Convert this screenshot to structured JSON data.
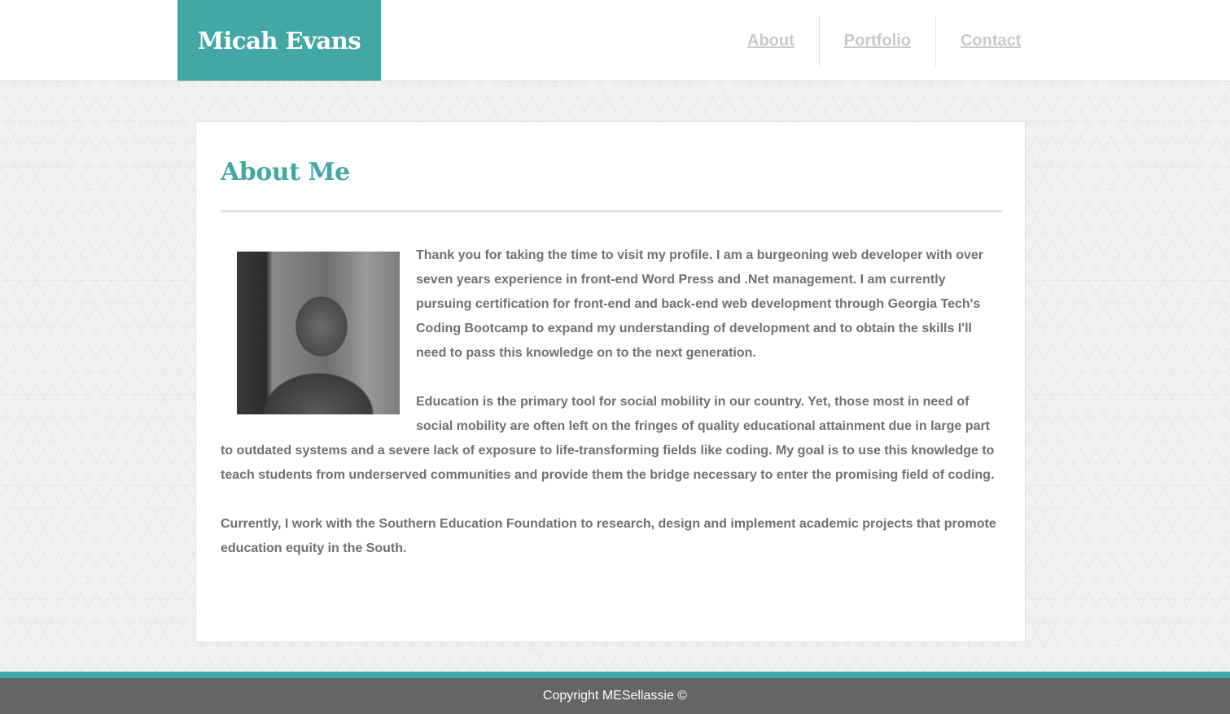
{
  "header": {
    "brand": "Micah Evans",
    "nav": [
      "About",
      "Portfolio",
      "Contact"
    ]
  },
  "about": {
    "title": "About Me",
    "photo_icon": "profile-photo",
    "paragraphs": [
      "Thank you for taking the time to visit my profile. I am a burgeoning web developer with over seven years experience in front-end Word Press and .Net management. I am currently pursuing certification for front-end and back-end web development through Georgia Tech's Coding Bootcamp to expand my understanding of development and to obtain the skills I'll need to pass this knowledge on to the next generation.",
      "Education is the primary tool for social mobility in our country. Yet, those most in need of social mobility are often left on the fringes of quality educational attainment due in large part to outdated systems and a severe lack of exposure to life-transforming fields like coding. My goal is to use this knowledge to teach students from underserved communities and provide them the bridge necessary to enter the promising field of coding.",
      "Currently, I work with the Southern Education Foundation to research, design and implement academic projects that promote education equity in the South."
    ]
  },
  "footer": {
    "copyright": "Copyright MESellassie ©"
  },
  "colors": {
    "accent": "#43a8a5",
    "footer": "#656565",
    "body_text": "#707070",
    "nav_text": "#c9c9c9"
  }
}
